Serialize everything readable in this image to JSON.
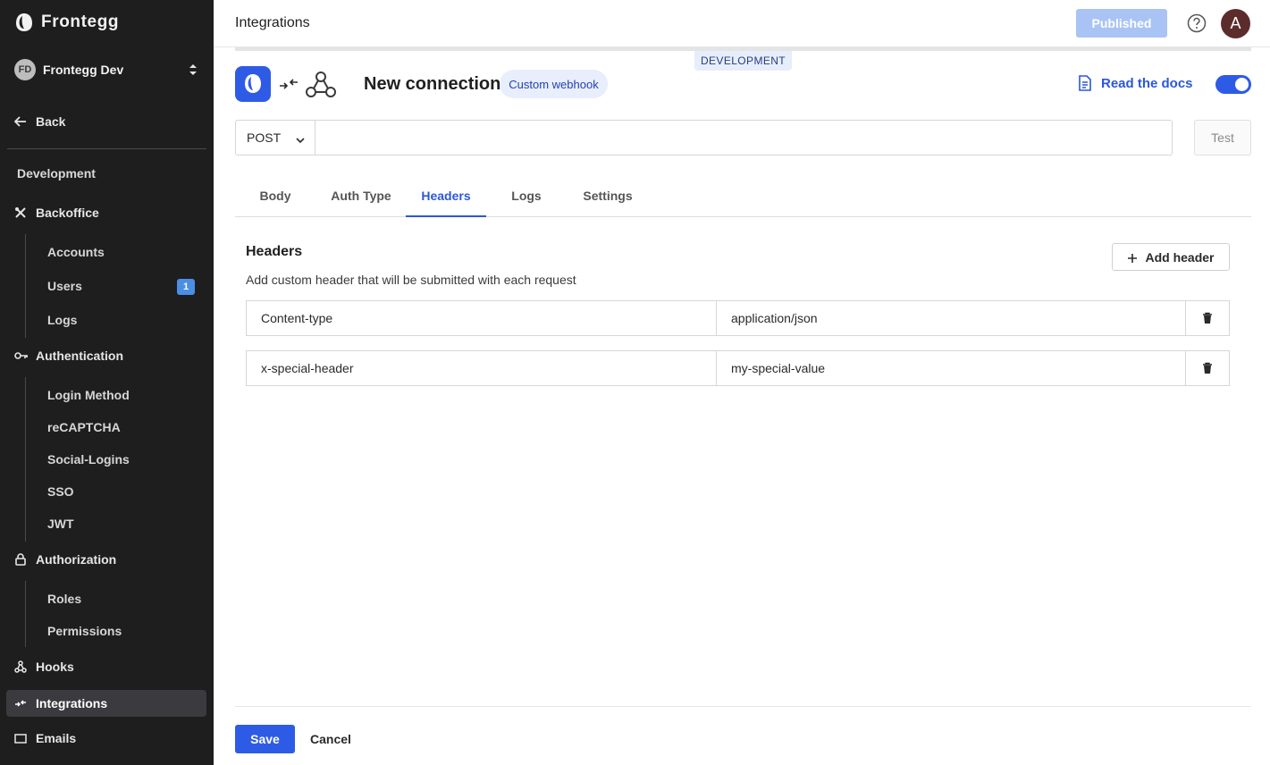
{
  "sidebar": {
    "brand": "Frontegg",
    "env_initials": "FD",
    "env_name": "Frontegg Dev",
    "back_label": "Back",
    "section_title": "Development",
    "backoffice": {
      "label": "Backoffice",
      "items": [
        "Accounts",
        "Users",
        "Logs"
      ],
      "users_badge": "1"
    },
    "authentication": {
      "label": "Authentication",
      "items": [
        "Login Method",
        "reCAPTCHA",
        "Social-Logins",
        "SSO",
        "JWT"
      ]
    },
    "authorization": {
      "label": "Authorization",
      "items": [
        "Roles",
        "Permissions"
      ]
    },
    "hooks_label": "Hooks",
    "integrations_label": "Integrations",
    "next_label": "Emails"
  },
  "topbar": {
    "title": "Integrations",
    "published_label": "Published",
    "avatar_letter": "A"
  },
  "env_tag": "DEVELOPMENT",
  "connection": {
    "title": "New connection",
    "chip": "Custom webhook",
    "docs_label": "Read the docs",
    "enabled": true
  },
  "request": {
    "method": "POST",
    "url": "",
    "url_placeholder": "",
    "test_label": "Test"
  },
  "tabs": [
    "Body",
    "Auth Type",
    "Headers",
    "Logs",
    "Settings"
  ],
  "active_tab": "Headers",
  "headers_section": {
    "title": "Headers",
    "description": "Add custom header that will be submitted with each request",
    "add_label": "Add header",
    "rows": [
      {
        "key": "Content-type",
        "value": "application/json"
      },
      {
        "key": "x-special-header",
        "value": "my-special-value"
      }
    ]
  },
  "footer": {
    "save_label": "Save",
    "cancel_label": "Cancel"
  },
  "colors": {
    "accent": "#2e5be6",
    "sidebar_bg": "#1e1e1e",
    "published_bg": "#a9c3f5",
    "badge": "#4a8ee6",
    "avatar": "#5c2c2c"
  }
}
